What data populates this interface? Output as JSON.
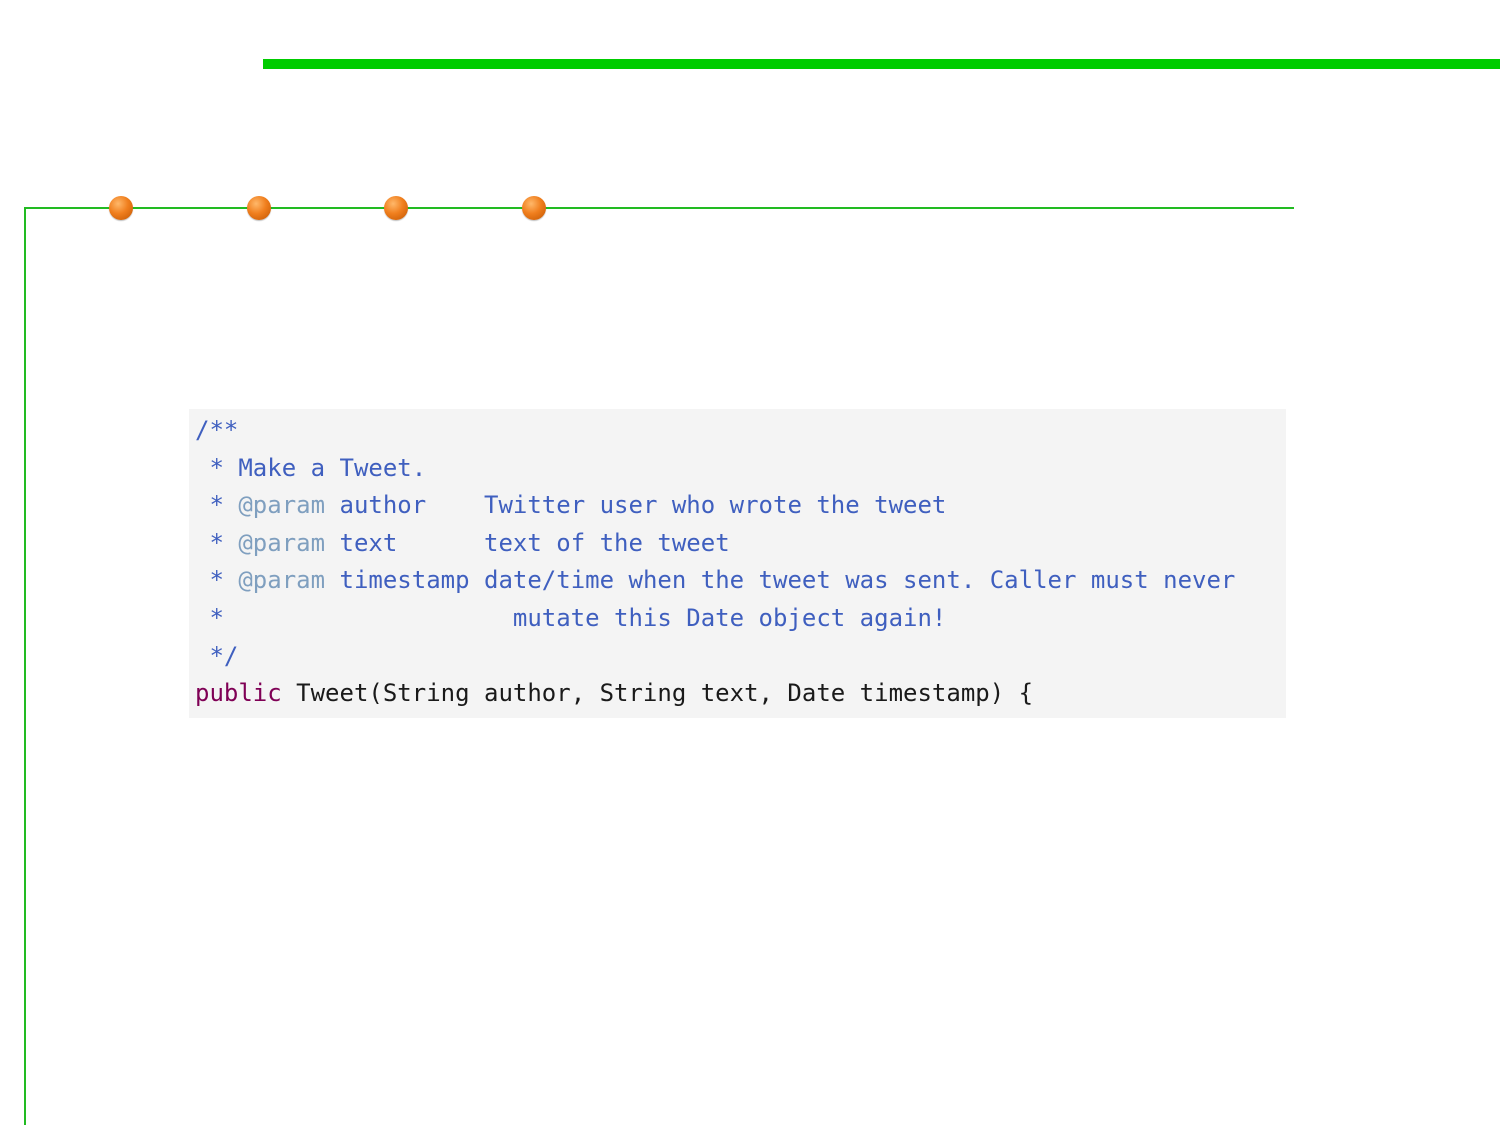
{
  "colors": {
    "accent_bar": "#00cc00",
    "rule": "#22bb22",
    "dot": "#f07f1e",
    "code_background": "#f4f4f4",
    "comment": "#3f5fbf",
    "javadoc_tag": "#7f9fbf",
    "keyword": "#7f0055",
    "code_text": "#1a1a1a"
  },
  "decorations": {
    "dot_count": 4
  },
  "code": {
    "line1": "/**",
    "line2": " * Make a Tweet.",
    "line3_prefix": " * ",
    "line3_tag": "@param",
    "line3_rest": " author    Twitter user who wrote the tweet",
    "line4_prefix": " * ",
    "line4_tag": "@param",
    "line4_rest": " text      text of the tweet",
    "line5_prefix": " * ",
    "line5_tag": "@param",
    "line5_rest": " timestamp date/time when the tweet was sent. Caller must never",
    "line6": " *                    mutate this Date object again!",
    "line7": " */",
    "line8_keyword": "public",
    "line8_rest": " Tweet(String author, String text, Date timestamp) {"
  }
}
